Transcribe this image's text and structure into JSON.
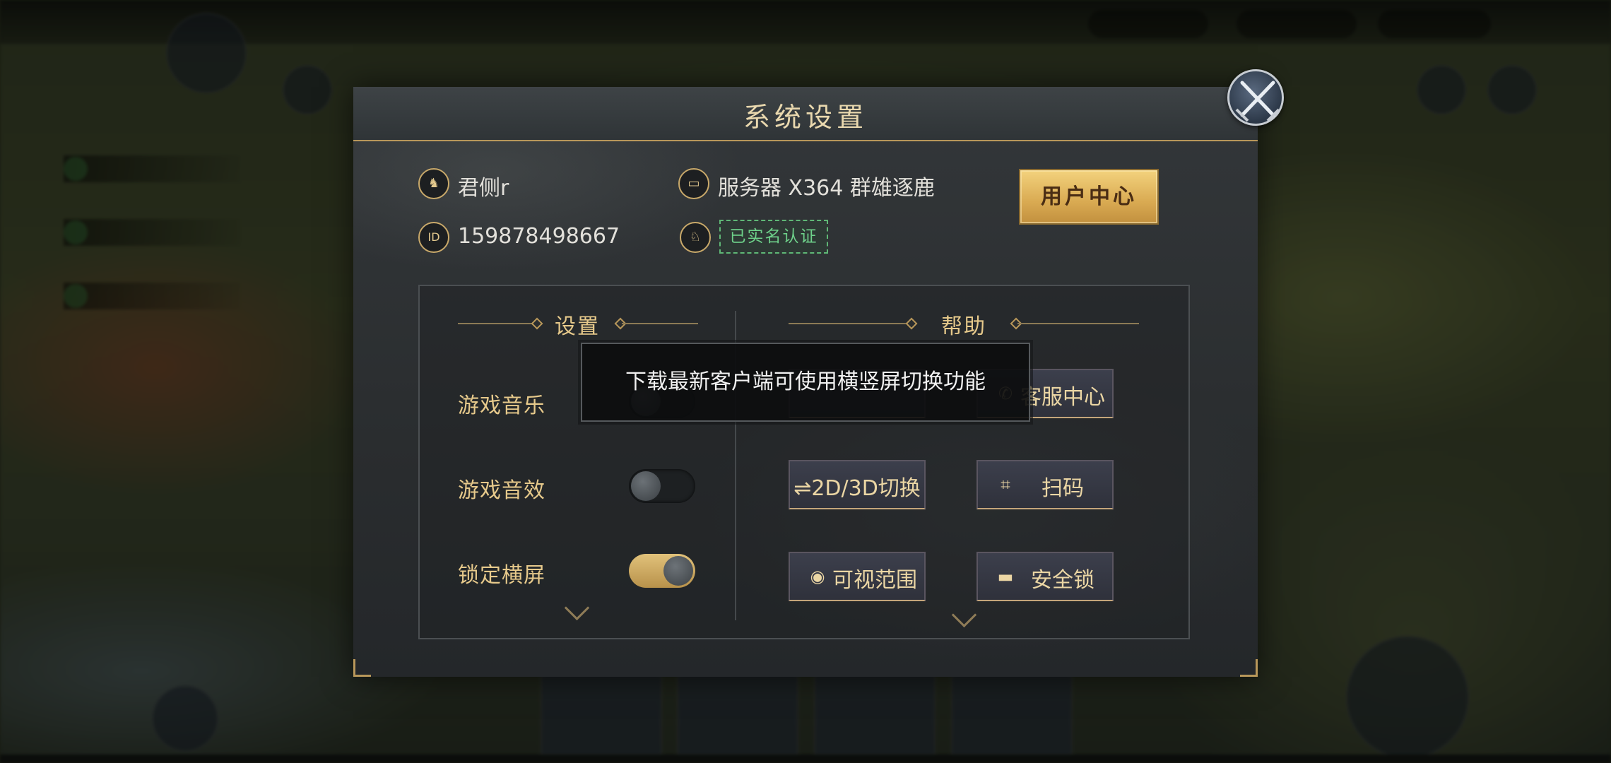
{
  "dialog": {
    "title": "系统设置",
    "user_name": "君侧r",
    "user_id": "159878498667",
    "server": "服务器 X364 群雄逐鹿",
    "verified_label": "已实名认证",
    "user_center_label": "用户中心",
    "id_icon_label": "ID"
  },
  "settings": {
    "section_title": "设置",
    "items": [
      {
        "label": "游戏音乐"
      },
      {
        "label": "游戏音效",
        "enabled": false
      },
      {
        "label": "锁定横屏",
        "enabled": true
      }
    ]
  },
  "help": {
    "section_title": "帮助",
    "buttons": [
      {
        "label": "客服中心",
        "icon": "phone-icon"
      },
      {
        "label": "⇌2D/3D切换",
        "icon": "swap-icon"
      },
      {
        "label": "扫码",
        "icon": "scan-icon"
      },
      {
        "label": "可视范围",
        "icon": "eye-icon"
      },
      {
        "label": "安全锁",
        "icon": "lock-icon"
      }
    ]
  },
  "toast": {
    "message": "下载最新客户端可使用横竖屏切换功能"
  },
  "colors": {
    "accent_gold": "#e6c98b",
    "verified_green": "#6ed18a",
    "toggle_on": "#d4b26a"
  }
}
